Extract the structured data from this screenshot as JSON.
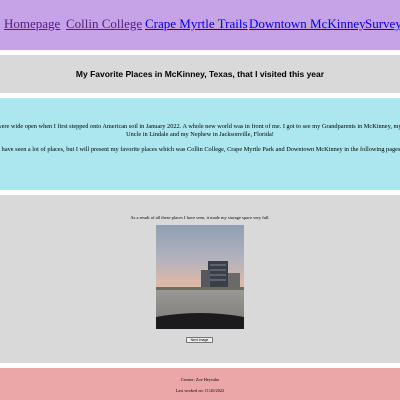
{
  "nav": {
    "items": [
      {
        "label": "Homepage"
      },
      {
        "label": "Collin College"
      },
      {
        "label": "Crape Myrtle Trails"
      },
      {
        "label": "Downtown McKinney"
      },
      {
        "label": "Survey"
      }
    ]
  },
  "header": {
    "title": "My Favorite Places in McKinney, Texas, that I visited this year"
  },
  "intro": {
    "paragraph1": "My eyes were wide open when I first stepped onto American soil in January 2022. A whole new world was in front of me. I got to see my Grandparents in McKinney, my Aunt and Uncle in Lindale and my Nephew in Jacksonville, Florida!",
    "paragraph2": "I have seen a lot of places, but I will present my favorite places which was Collin College, Crape Myrtle Park and Downtown McKinney in the following pages."
  },
  "gallery": {
    "caption": "As a result of all these places I have seen, it made my storage space very full.",
    "button_label": "Next image"
  },
  "footer": {
    "creator": "Creator: Zoe Heyvaho",
    "last_worked": "Last worked on: 11/20/2022"
  }
}
